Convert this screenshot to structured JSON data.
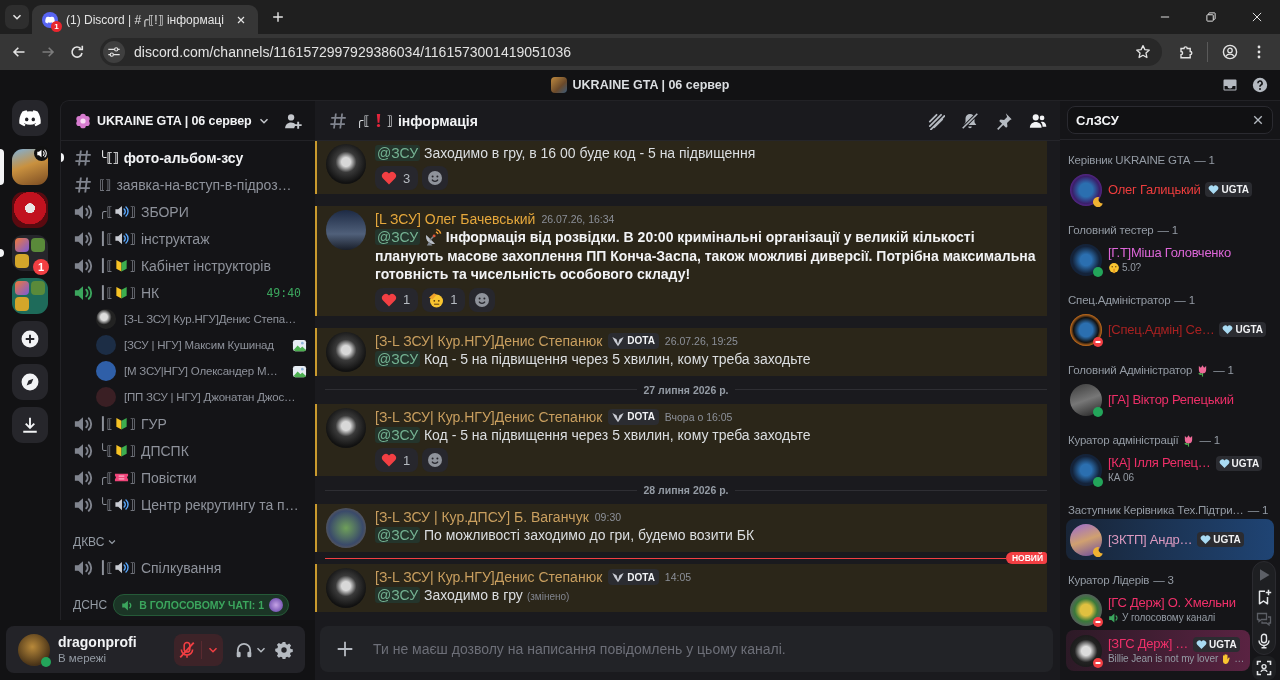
{
  "browser": {
    "tab": {
      "title": "(1) Discord | #╭⟦!⟧ інформаці",
      "favicon_badge": "1"
    },
    "nav": [
      {
        "kind": "back",
        "disabled": false
      },
      {
        "kind": "forward",
        "disabled": true
      },
      {
        "kind": "reload",
        "disabled": false
      }
    ],
    "url": "discord.com/channels/1161572997929386034/1161573001419051036"
  },
  "app_title": "UKRAINE GTA | 06 сервер",
  "servers": [
    {
      "kind": "home",
      "selected": false,
      "unread": false
    },
    {
      "kind": "server",
      "selected": true,
      "unread": false,
      "voice": true
    },
    {
      "kind": "server",
      "selected": false,
      "unread": false,
      "voice": false
    },
    {
      "kind": "folder",
      "selected": false,
      "unread": true,
      "badge": "1"
    },
    {
      "kind": "folder",
      "selected": false,
      "unread": false,
      "color": "#1e6b5a"
    },
    {
      "kind": "add",
      "selected": false,
      "unread": false
    },
    {
      "kind": "discover",
      "selected": false,
      "unread": false
    },
    {
      "kind": "download",
      "selected": false,
      "unread": false
    }
  ],
  "guild": {
    "name": "UKRAINE GTA | 06 сервер"
  },
  "channels": [
    {
      "kind": "text",
      "unread": true,
      "label_start": "╰⟦⟧",
      "name": "фото-альбом-зсу"
    },
    {
      "kind": "text",
      "unread": false,
      "label_start": "⟦⟧",
      "name": "заявка-на-вступ-в-підроз…"
    },
    {
      "kind": "voice",
      "unread": false,
      "active": false,
      "label_start": "╭⟦",
      "emoji": {
        "kind": "speaker"
      },
      "label_end": "⟧",
      "name": "ЗБОРИ"
    },
    {
      "kind": "voice",
      "unread": false,
      "active": false,
      "label_start": "┃⟦",
      "emoji": {
        "kind": "speaker"
      },
      "label_end": "⟧",
      "name": "інструктаж"
    },
    {
      "kind": "voice",
      "unread": false,
      "active": false,
      "label_start": "┃⟦",
      "emoji": {
        "kind": "beginner"
      },
      "label_end": "⟧",
      "name": "Кабінет інструкторів"
    },
    {
      "kind": "voice",
      "unread": false,
      "active": true,
      "label_start": "┃⟦",
      "emoji": {
        "kind": "beginner"
      },
      "label_end": "⟧",
      "name": "НК",
      "timer": "49:40",
      "children": [
        {
          "name": "[З-L ЗСУ| Кур.НГУ]Денис Степа…",
          "activity": false
        },
        {
          "name": "[ЗСУ | НГУ] Максим Кушинад",
          "activity": true
        },
        {
          "name": "[М ЗСУ|НГУ] Олександер М…",
          "activity": true
        },
        {
          "name": "[ПП ЗСУ | НГУ] Джонатан Джос…",
          "activity": false
        }
      ]
    },
    {
      "kind": "voice",
      "unread": false,
      "active": false,
      "label_start": "┃⟦",
      "emoji": {
        "kind": "beginner"
      },
      "label_end": "⟧",
      "name": "ГУР"
    },
    {
      "kind": "voice",
      "unread": false,
      "active": false,
      "label_start": "╰⟦",
      "emoji": {
        "kind": "beginner"
      },
      "label_end": "⟧",
      "name": "ДПСПК"
    },
    {
      "kind": "voice",
      "unread": false,
      "active": false,
      "label_start": "╭⟦",
      "emoji": {
        "kind": "ticket"
      },
      "label_end": "⟧",
      "name": "Повістки"
    },
    {
      "kind": "voice",
      "unread": false,
      "active": false,
      "label_start": "╰⟦",
      "emoji": {
        "kind": "speaker"
      },
      "label_end": "⟧",
      "name": "Центр рекрутингу та п…"
    },
    {
      "kind": "category",
      "name": "ДКВС",
      "expanded": true
    },
    {
      "kind": "voice",
      "unread": false,
      "active": false,
      "label_start": "┃⟦",
      "emoji": {
        "kind": "speaker"
      },
      "label_end": "⟧",
      "name": "Спілкування"
    },
    {
      "kind": "category",
      "name": "ДСНС",
      "activity": "В ГОЛОСОВОМУ ЧАТІ: 1"
    }
  ],
  "user": {
    "name": "dragonprofi",
    "status_text": "В мережі",
    "status": {
      "kind": "online"
    },
    "muted": true,
    "deafened": false
  },
  "channel_header": {
    "label_start": "╭⟦",
    "emoji": {
      "kind": "exclamation"
    },
    "label_end": "⟧",
    "name": "інформація",
    "tools": [
      {
        "kind": "threads",
        "selected": false
      },
      {
        "kind": "notifications",
        "selected": false
      },
      {
        "kind": "pins",
        "selected": false
      },
      {
        "kind": "members",
        "selected": true
      }
    ]
  },
  "feed": [
    {
      "kind": "message",
      "mentioned": true,
      "bold": false,
      "mention": "@ЗСУ",
      "text": "Заходимо в гру, в 16 00 буде код - 5 на підвищення",
      "reactions": [
        {
          "kind": "heart",
          "count": "3"
        }
      ]
    },
    {
      "kind": "message",
      "mentioned": true,
      "bold": true,
      "author": "[L ЗСУ] Олег Бачевський",
      "color": "#e6a83c",
      "time": "26.07.26, 16:34",
      "mention": "@ЗСУ",
      "emoji": {
        "kind": "satellite"
      },
      "text": "Інформація від розвідки. В 20:00 кримінальні організації у великій кількості планують масове захоплення ПП Конча-Заспа, також можливі диверсії. Потрібна максимальна готовність та чисельність особового складу!",
      "reactions": [
        {
          "kind": "heart",
          "count": "1"
        },
        {
          "kind": "salute",
          "count": "1"
        }
      ]
    },
    {
      "kind": "message",
      "mentioned": true,
      "bold": false,
      "author": "[З-L ЗСУ| Кур.НГУ]Денис Степанюк",
      "color": "#c99f5f",
      "tag": "DOTA",
      "time": "26.07.26, 19:25",
      "mention": "@ЗСУ",
      "text": "Код - 5 на підвищення через 5 хвилин, кому треба заходьте"
    },
    {
      "kind": "date_divider",
      "label": "27 липня 2026 р."
    },
    {
      "kind": "message",
      "mentioned": true,
      "bold": false,
      "author": "[З-L ЗСУ| Кур.НГУ]Денис Степанюк",
      "color": "#c99f5f",
      "tag": "DOTA",
      "time": "Вчора о 16:05",
      "mention": "@ЗСУ",
      "text": "Код - 5 на підвищення через 5 хвилин, кому треба заходьте",
      "reactions": [
        {
          "kind": "heart",
          "count": "1"
        }
      ]
    },
    {
      "kind": "date_divider",
      "label": "28 липня 2026 р."
    },
    {
      "kind": "message",
      "mentioned": true,
      "bold": false,
      "author": "[З-L ЗСУ | Кур.ДПСУ] Б. Ваганчук",
      "color": "#c99f5f",
      "time": "09:30",
      "mention": "@ЗСУ",
      "text": "По можливості заходимо до гри, будемо возити БК"
    },
    {
      "kind": "new_divider",
      "label": "НОВИЙ"
    },
    {
      "kind": "message",
      "mentioned": true,
      "bold": false,
      "author": "[З-L ЗСУ| Кур.НГУ]Денис Степанюк",
      "color": "#c99f5f",
      "tag": "DOTA",
      "time": "14:05",
      "mention": "@ЗСУ",
      "text": "Заходимо в гру",
      "edited": "(змінено)"
    }
  ],
  "composer": {
    "placeholder": "Ти не маєш дозволу на написання повідомлень у цьому каналі."
  },
  "members": {
    "search": "СлЗСУ",
    "groups": [
      {
        "title": "Керівник UKRAINE GTA",
        "count": "— 1",
        "members": [
          {
            "name": "Олег Галицький",
            "color": "#ed3d3d",
            "status": {
              "kind": "idle"
            },
            "tag": "UGTA"
          }
        ]
      },
      {
        "title": "Головний тестер",
        "count": "— 1",
        "members": [
          {
            "name": "[Г.Т]Міша Головченко",
            "color": "#dd66d8",
            "status": {
              "kind": "online"
            },
            "sub": "5.0?",
            "sub_icon": {
              "kind": "shush"
            }
          }
        ]
      },
      {
        "title": "Спец.Адміністратор",
        "count": "— 1",
        "members": [
          {
            "name": "[Спец.Адмін] Се…",
            "color": "#a82121",
            "status": {
              "kind": "dnd"
            },
            "tag": "UGTA"
          }
        ]
      },
      {
        "title": "Головний Адміністратор",
        "emoji": {
          "kind": "tulip"
        },
        "count": "— 1",
        "members": [
          {
            "name": "[ГА] Віктор Репецький",
            "color": "#ee2f68",
            "status": {
              "kind": "online"
            }
          }
        ]
      },
      {
        "title": "Куратор адміністрації",
        "emoji": {
          "kind": "tulip"
        },
        "count": "— 1",
        "members": [
          {
            "name": "[КА] Ілля Репец…",
            "color": "#ee2f68",
            "status": {
              "kind": "online"
            },
            "tag": "UGTA",
            "sub": "КА 06"
          }
        ]
      },
      {
        "title": "Заступник Керівника Тех.Підтри…",
        "count": "— 1",
        "members": [
          {
            "name": "[ЗКТП] Андр…",
            "color": "#dc9ac0",
            "status": {
              "kind": "idle"
            },
            "tag": "UGTA",
            "nameplate": {
              "color": "#1f4474"
            }
          }
        ]
      },
      {
        "title": "Куратор Лідерів",
        "count": "— 3",
        "members": [
          {
            "name": "[ГС Держ] О. Хмельни",
            "color": "#f0306a",
            "status": {
              "kind": "dnd"
            },
            "sub": "У голосовому каналі",
            "sub_icon": {
              "kind": "voice"
            }
          },
          {
            "name": "[ЗГС Держ] …",
            "color": "#f0306a",
            "status": {
              "kind": "dnd"
            },
            "tag": "UGTA",
            "sub": "Billie Jean is not my lover",
            "sub_end_icon": {
              "kind": "hand"
            },
            "sub_end": "…",
            "nameplate": {
              "color": "#5a2342"
            }
          }
        ]
      }
    ]
  },
  "overlay_tools": [
    {
      "kind": "play",
      "disabled": true
    },
    {
      "kind": "bookmark",
      "disabled": false
    },
    {
      "kind": "chat",
      "disabled": true
    },
    {
      "kind": "mic",
      "disabled": false
    },
    {
      "kind": "capture",
      "disabled": false
    }
  ]
}
